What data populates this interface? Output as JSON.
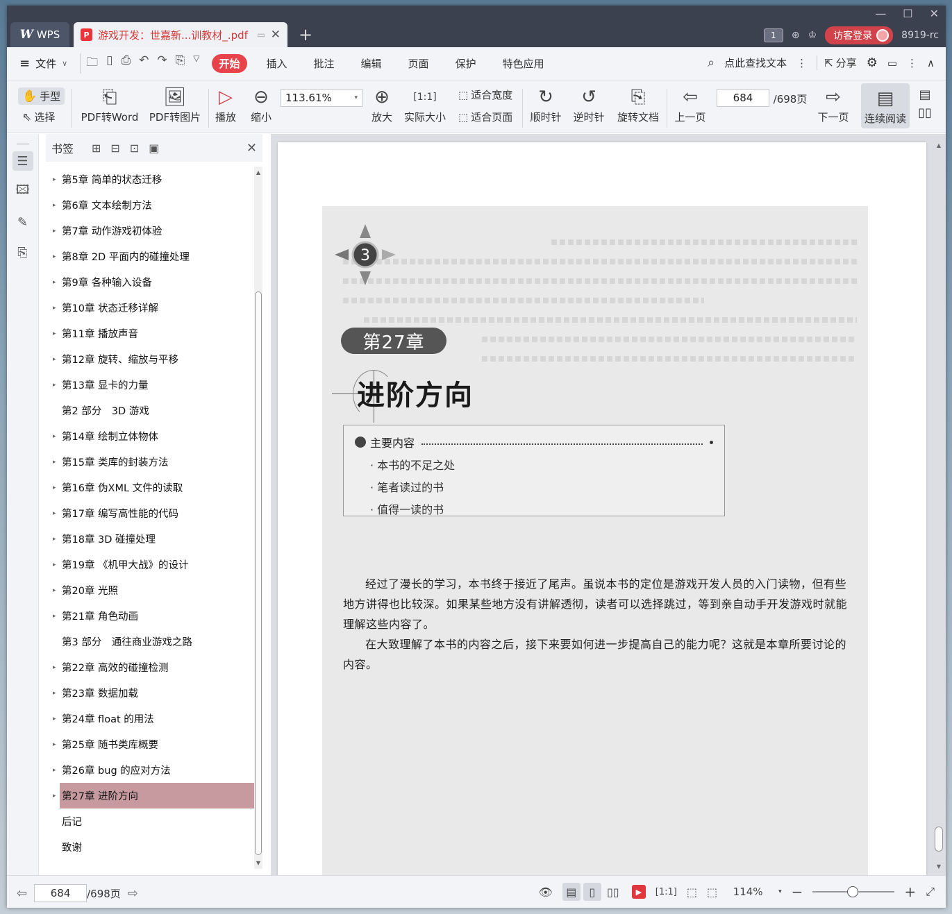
{
  "titlebar": {
    "app_name": "WPS",
    "doc_tab_title": "游戏开发：世嘉新...训教材_.pdf",
    "badge": "1",
    "login": "访客登录",
    "user_id": "8919-rc"
  },
  "menubar": {
    "file": "文件",
    "tabs": [
      "开始",
      "插入",
      "批注",
      "编辑",
      "页面",
      "保护",
      "特色应用"
    ],
    "search": "点此查找文本",
    "share": "分享"
  },
  "ribbon": {
    "hand": "手型",
    "select": "选择",
    "pdf_to_word": "PDF转Word",
    "pdf_to_image": "PDF转图片",
    "play": "播放",
    "zoom_out": "缩小",
    "zoom_value": "113.61%",
    "zoom_in": "放大",
    "actual_size": "实际大小",
    "fit_width": "适合宽度",
    "fit_page": "适合页面",
    "clockwise": "顺时针",
    "counter_clockwise": "逆时针",
    "rotate_doc": "旋转文档",
    "prev_page": "上一页",
    "page_value": "684",
    "page_total": "/698页",
    "next_page": "下一页",
    "continuous": "连续阅读"
  },
  "bookmark": {
    "title": "书签",
    "items": [
      {
        "label": "第5章 简单的状态迁移",
        "arrow": true
      },
      {
        "label": "第6章 文本绘制方法",
        "arrow": true
      },
      {
        "label": "第7章 动作游戏初体验",
        "arrow": true
      },
      {
        "label": "第8章 2D 平面内的碰撞处理",
        "arrow": true
      },
      {
        "label": "第9章 各种输入设备",
        "arrow": true
      },
      {
        "label": "第10章 状态迁移详解",
        "arrow": true
      },
      {
        "label": "第11章 播放声音",
        "arrow": true
      },
      {
        "label": "第12章 旋转、缩放与平移",
        "arrow": true
      },
      {
        "label": "第13章 显卡的力量",
        "arrow": true
      },
      {
        "label": "第2 部分　3D 游戏",
        "arrow": false
      },
      {
        "label": "第14章 绘制立体物体",
        "arrow": true
      },
      {
        "label": "第15章 类库的封装方法",
        "arrow": true
      },
      {
        "label": "第16章 伪XML 文件的读取",
        "arrow": true
      },
      {
        "label": "第17章 编写高性能的代码",
        "arrow": true
      },
      {
        "label": "第18章 3D 碰撞处理",
        "arrow": true
      },
      {
        "label": "第19章 《机甲大战》的设计",
        "arrow": true
      },
      {
        "label": "第20章 光照",
        "arrow": true
      },
      {
        "label": "第21章 角色动画",
        "arrow": true
      },
      {
        "label": "第3 部分　通往商业游戏之路",
        "arrow": false
      },
      {
        "label": "第22章 高效的碰撞检测",
        "arrow": true
      },
      {
        "label": "第23章 数据加载",
        "arrow": true
      },
      {
        "label": "第24章 float 的用法",
        "arrow": true
      },
      {
        "label": "第25章 随书类库概要",
        "arrow": true
      },
      {
        "label": "第26章 bug 的应对方法",
        "arrow": true
      },
      {
        "label": "第27章 进阶方向",
        "arrow": true,
        "selected": true
      },
      {
        "label": "后记",
        "arrow": false
      },
      {
        "label": "致谢",
        "arrow": false
      }
    ]
  },
  "page": {
    "part_number": "3",
    "chapter_badge": "第27章",
    "chapter_title": "进阶方向",
    "summary_head": "主要内容",
    "summary_items": [
      "本书的不足之处",
      "笔者读过的书",
      "值得一读的书"
    ],
    "paragraphs": [
      "经过了漫长的学习，本书终于接近了尾声。虽说本书的定位是游戏开发人员的入门读物，但有些地方讲得也比较深。如果某些地方没有讲解透彻，读者可以选择跳过，等到亲自动手开发游戏时就能理解这些内容了。",
      "在大致理解了本书的内容之后，接下来要如何进一步提高自己的能力呢？这就是本章所要讨论的内容。"
    ]
  },
  "status": {
    "page_value": "684",
    "page_total": "/698页",
    "zoom": "114%"
  },
  "colors": {
    "accent": "#e8434a",
    "titlebar": "#3c4150",
    "selected_bookmark": "#c79aa0"
  }
}
